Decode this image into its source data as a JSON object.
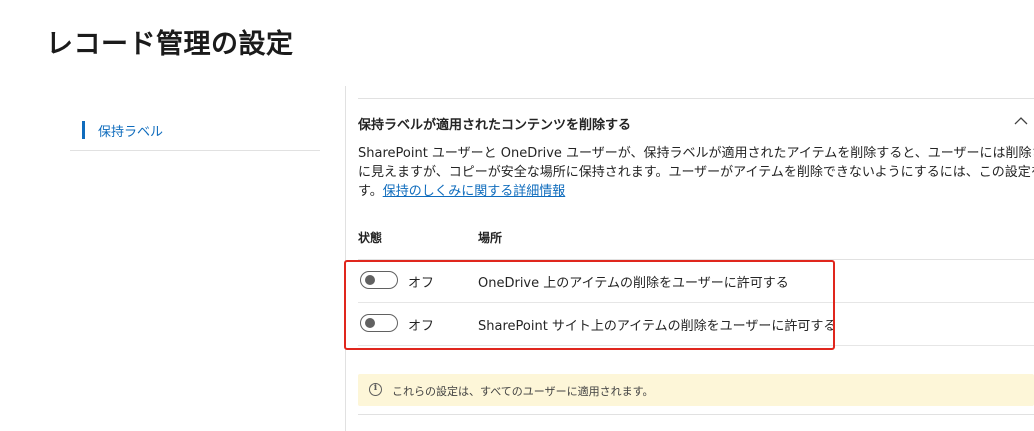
{
  "page": {
    "title": "レコード管理の設定"
  },
  "nav": {
    "items": [
      {
        "label": "保持ラベル",
        "selected": true
      }
    ]
  },
  "section": {
    "title": "保持ラベルが適用されたコンテンツを削除する",
    "expanded": true,
    "description_lines": [
      "SharePoint ユーザーと OneDrive ユーザーが、保持ラベルが適用されたアイテムを削除すると、ユーザーには削除されたよう",
      "に見えますが、コピーが安全な場所に保持されます。ユーザーがアイテムを削除できないようにするには、この設定をオフにしま",
      "す。"
    ],
    "link_text": "保持のしくみに関する詳細情報",
    "columns": {
      "state": "状態",
      "place": "場所"
    },
    "rows": [
      {
        "state_label": "オフ",
        "enabled": false,
        "text": "OneDrive 上のアイテムの削除をユーザーに許可する"
      },
      {
        "state_label": "オフ",
        "enabled": false,
        "text": "SharePoint サイト上のアイテムの削除をユーザーに許可する"
      }
    ],
    "info_message": "これらの設定は、すべてのユーザーに適用されます。"
  },
  "colors": {
    "accent": "#0f6cbd",
    "highlight_border": "#e0261d",
    "info_background": "#fdf6d8"
  }
}
